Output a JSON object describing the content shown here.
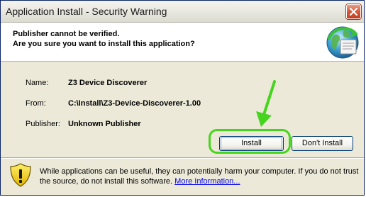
{
  "window": {
    "title": "Application Install - Security Warning"
  },
  "header": {
    "line1": "Publisher cannot be verified.",
    "line2": "Are you sure you want to install this application?"
  },
  "details": {
    "name_label": "Name:",
    "name_value": "Z3 Device Discoverer",
    "from_label": "From:",
    "from_value": "C:\\Install\\Z3-Device-Discoverer-1.00",
    "publisher_label": "Publisher:",
    "publisher_value": "Unknown Publisher"
  },
  "buttons": {
    "install": "Install",
    "dont_install": "Don't Install"
  },
  "footer": {
    "warning_text": "While applications can be useful, they can potentially harm your computer. If you do not trust the source, do not install this software. ",
    "link_text": "More Information..."
  },
  "icons": {
    "title_close": "close-icon",
    "header": "globe-install-icon",
    "footer": "warning-shield-icon",
    "annotation": "green-arrow"
  },
  "colors": {
    "highlight": "#46d51f",
    "link": "#0000ee",
    "close_button": "#c03d1f"
  }
}
